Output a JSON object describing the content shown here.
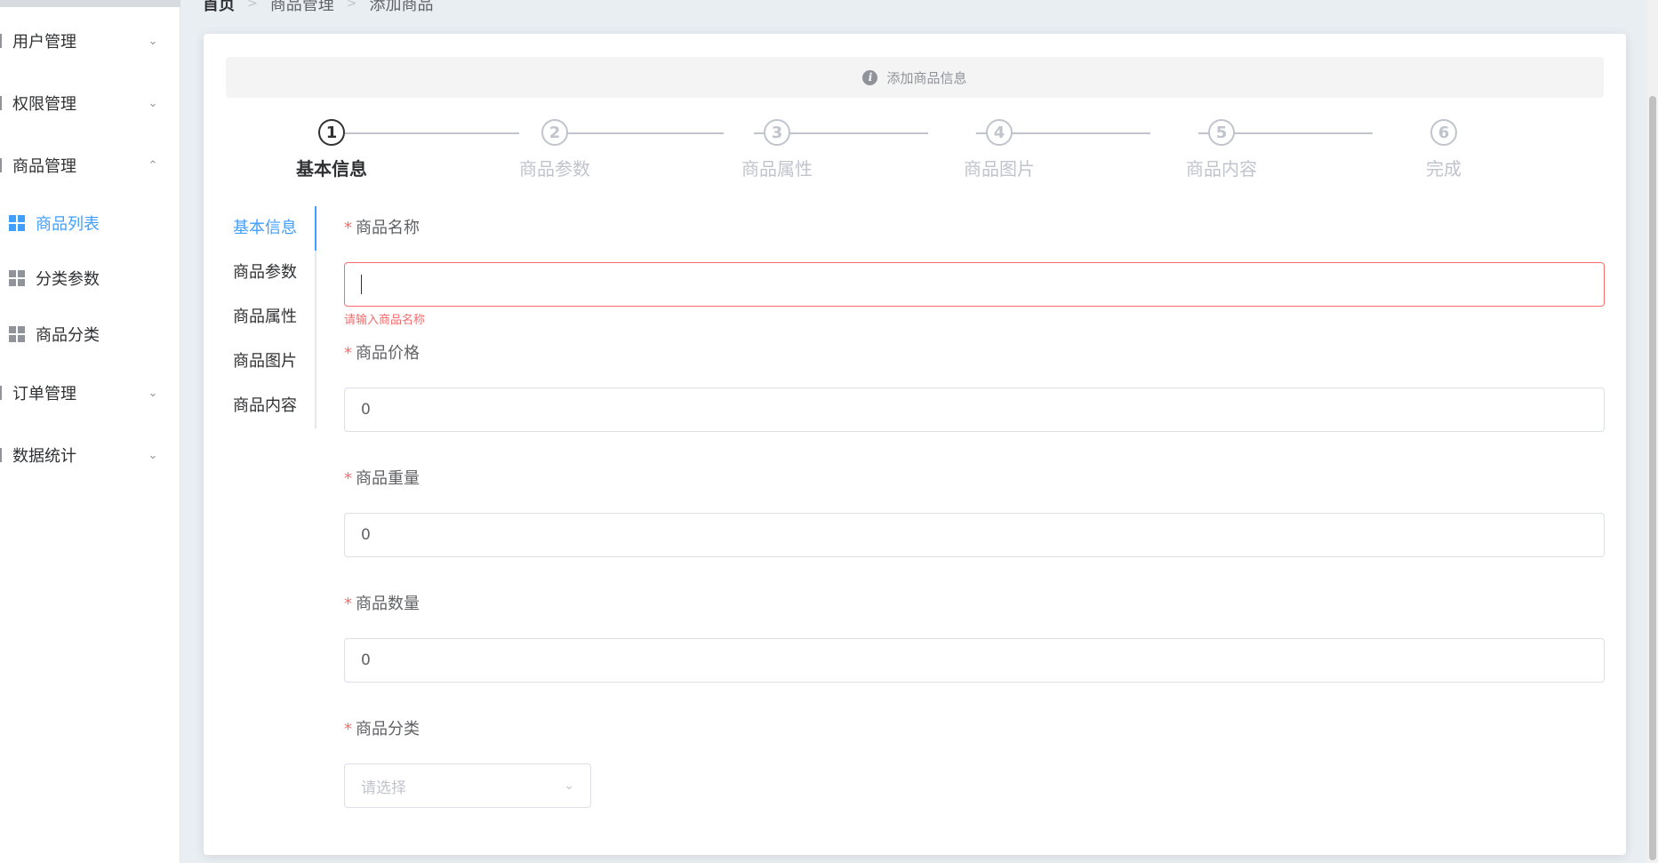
{
  "colors": {
    "primary": "#409eff",
    "danger": "#f56c6c",
    "text": "#303133",
    "muted": "#c0c4cc"
  },
  "sidebar": {
    "menus": [
      {
        "label": "用户管理",
        "icon": "user-icon",
        "chevron": "chevron-down-icon"
      },
      {
        "label": "权限管理",
        "icon": "lock-icon",
        "chevron": "chevron-down-icon"
      },
      {
        "label": "商品管理",
        "icon": "goods-icon",
        "chevron": "chevron-up-icon"
      },
      {
        "label": "订单管理",
        "icon": "order-icon",
        "chevron": "chevron-down-icon"
      },
      {
        "label": "数据统计",
        "icon": "stats-icon",
        "chevron": "chevron-down-icon"
      }
    ],
    "sub_items": [
      {
        "label": "商品列表",
        "active": true
      },
      {
        "label": "分类参数",
        "active": false
      },
      {
        "label": "商品分类",
        "active": false
      }
    ]
  },
  "breadcrumb": {
    "items": [
      "首页",
      "商品管理",
      "添加商品"
    ]
  },
  "alert": {
    "text": "添加商品信息"
  },
  "steps": {
    "active_index": 0,
    "items": [
      {
        "number": "1",
        "title": "基本信息"
      },
      {
        "number": "2",
        "title": "商品参数"
      },
      {
        "number": "3",
        "title": "商品属性"
      },
      {
        "number": "4",
        "title": "商品图片"
      },
      {
        "number": "5",
        "title": "商品内容"
      },
      {
        "number": "6",
        "title": "完成"
      }
    ]
  },
  "tabs": {
    "items": [
      "基本信息",
      "商品参数",
      "商品属性",
      "商品图片",
      "商品内容"
    ],
    "active_index": 0
  },
  "form": {
    "name": {
      "label": "商品名称",
      "required": "*",
      "value": "",
      "error": "请输入商品名称"
    },
    "price": {
      "label": "商品价格",
      "required": "*",
      "value": "0"
    },
    "weight": {
      "label": "商品重量",
      "required": "*",
      "value": "0"
    },
    "number": {
      "label": "商品数量",
      "required": "*",
      "value": "0"
    },
    "category": {
      "label": "商品分类",
      "required": "*",
      "placeholder": "请选择"
    }
  }
}
